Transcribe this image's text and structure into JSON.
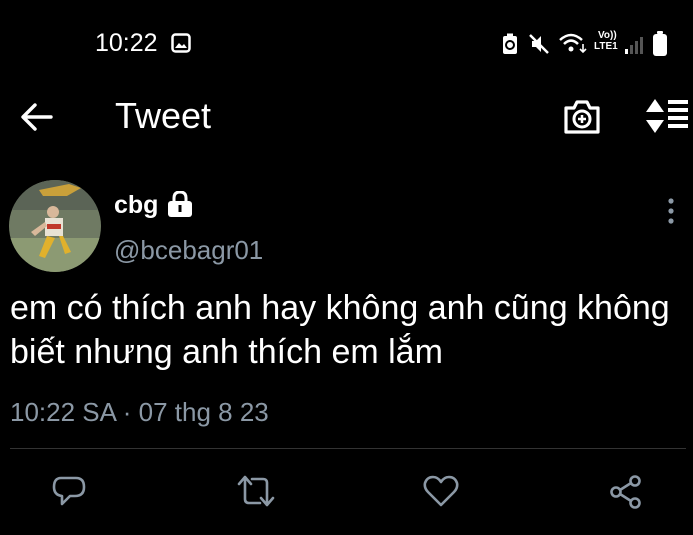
{
  "status_bar": {
    "time": "10:22",
    "network_top": "Vo))",
    "network_bottom": "LTE1"
  },
  "header": {
    "title": "Tweet"
  },
  "tweet": {
    "display_name": "cbg",
    "handle": "@bcebagr01",
    "text": "em có thích anh hay không anh cũng không biết nhưng anh thích em lắm",
    "meta": "10:22 SA · 07 thg 8 23"
  },
  "icons": {
    "back": "arrow-left-icon",
    "camera": "camera-add-icon",
    "sort": "sort-icon",
    "more": "more-vertical-icon",
    "lock": "lock-icon",
    "reply": "reply-icon",
    "retweet": "retweet-icon",
    "like": "heart-icon",
    "share": "share-icon"
  },
  "colors": {
    "background": "#000000",
    "text": "#ffffff",
    "secondary_text": "#8b98a5",
    "divider": "#333333"
  }
}
